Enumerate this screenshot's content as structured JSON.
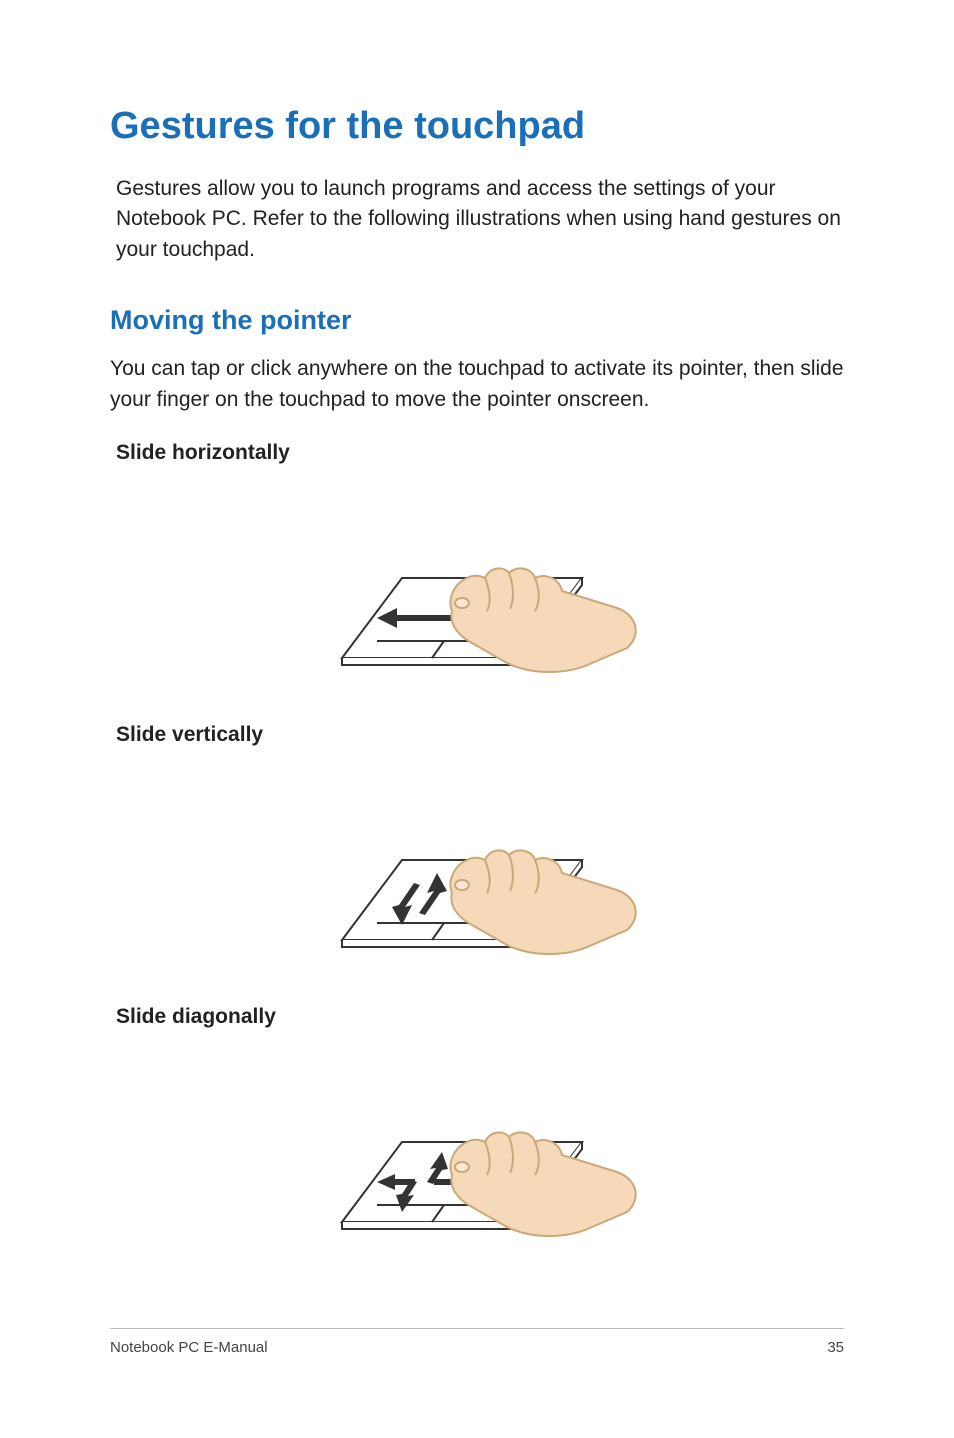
{
  "heading": "Gestures for the touchpad",
  "intro": "Gestures allow you to launch programs and access the settings of your Notebook PC. Refer to the following illustrations when using hand gestures on your touchpad.",
  "section": {
    "title": "Moving the pointer",
    "body": "You can tap or click anywhere on the touchpad to activate its pointer, then slide your finger on the touchpad to move the pointer onscreen.",
    "gestures": [
      {
        "label": "Slide horizontally",
        "type": "horizontal"
      },
      {
        "label": "Slide vertically",
        "type": "vertical"
      },
      {
        "label": "Slide diagonally",
        "type": "diagonal"
      }
    ]
  },
  "footer": {
    "left": "Notebook PC E-Manual",
    "right": "35"
  },
  "colors": {
    "heading_blue": "#1a6fb8",
    "skin": "#f5d9b8",
    "skin_line": "#c9a97a",
    "arrow": "#333333"
  }
}
